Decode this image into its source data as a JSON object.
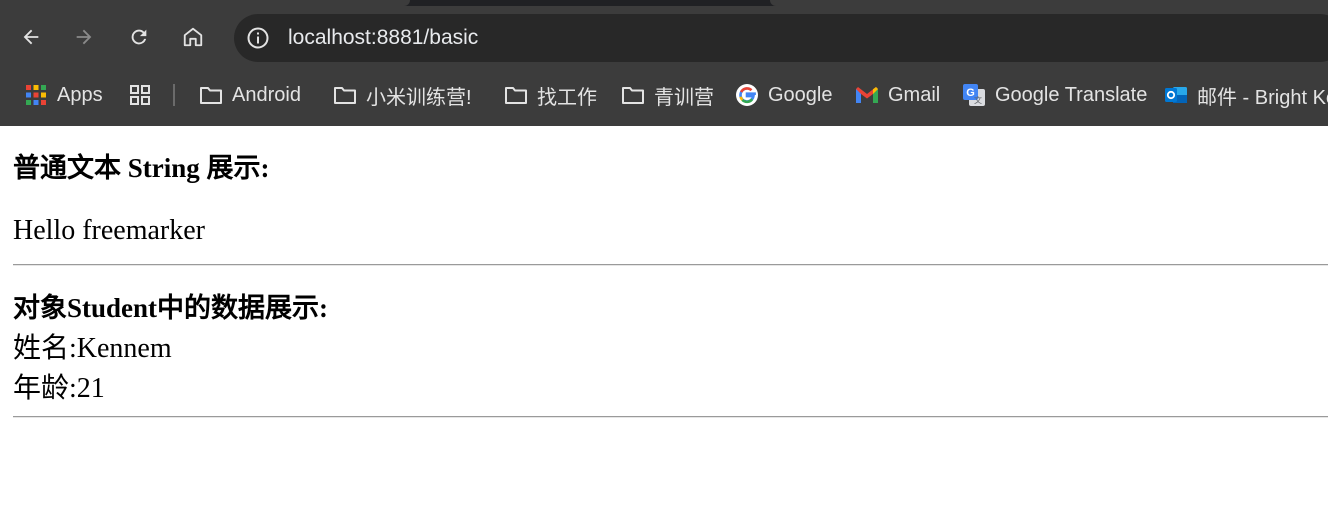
{
  "browser": {
    "address_bar": {
      "url": "localhost:8881/basic"
    },
    "bookmarks": [
      {
        "label": "Apps",
        "icon": "apps-grid-icon"
      },
      {
        "label": "",
        "icon": "tab-groups-icon"
      },
      {
        "label": "Android",
        "icon": "folder-icon"
      },
      {
        "label": "小米训练营!",
        "icon": "folder-icon"
      },
      {
        "label": "找工作",
        "icon": "folder-icon"
      },
      {
        "label": "青训营",
        "icon": "folder-icon"
      },
      {
        "label": "Google",
        "icon": "google-icon"
      },
      {
        "label": "Gmail",
        "icon": "gmail-icon"
      },
      {
        "label": "Google Translate",
        "icon": "google-translate-icon"
      },
      {
        "label": "邮件 - Bright Ke",
        "icon": "outlook-icon"
      }
    ],
    "colors": {
      "chrome_bg": "#3c3c3c",
      "omnibox_bg": "#282828",
      "chrome_text": "#e3e3e3"
    }
  },
  "page": {
    "string_heading": "普通文本 String 展示:",
    "string_value": "Hello freemarker",
    "student_heading": "对象Student中的数据展示:",
    "name_label": "姓名:",
    "name_value": "Kennem",
    "age_label": "年龄:",
    "age_value": "21"
  }
}
